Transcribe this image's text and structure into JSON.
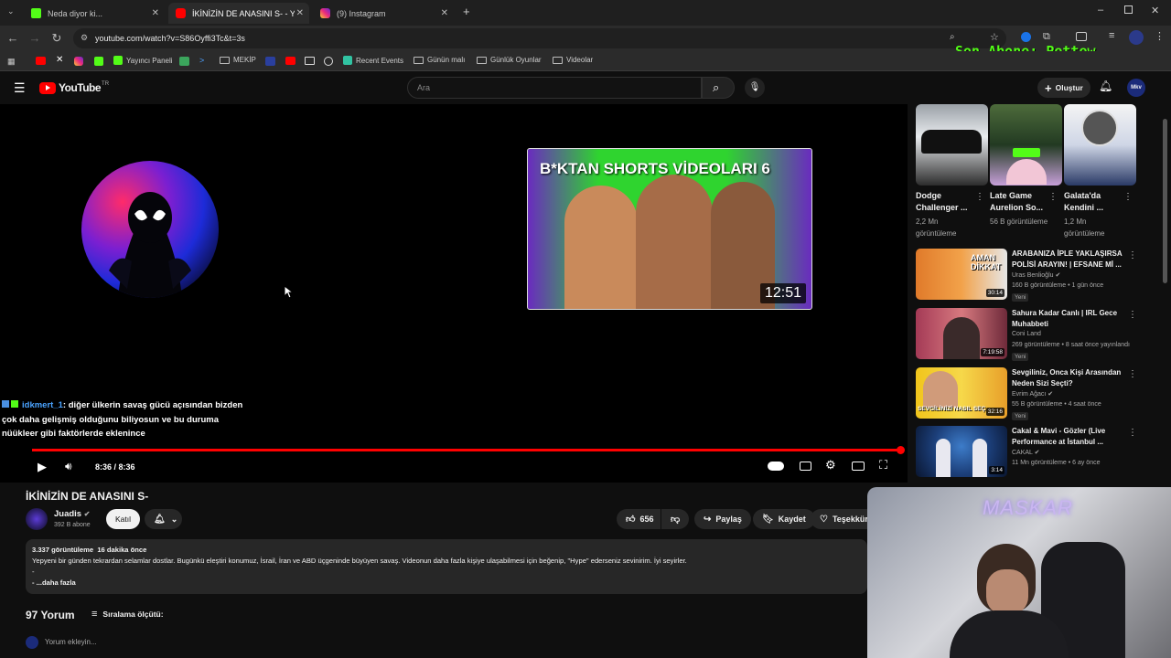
{
  "browser": {
    "tabs": [
      {
        "title": "Neda diyor ki...",
        "color": "#53fc18"
      },
      {
        "title": "İKİNİZİN DE ANASINI S- - YouT",
        "color": "#ff0000"
      },
      {
        "title": "(9) Instagram",
        "color": "#e1306c"
      }
    ],
    "url": "youtube.com/watch?v=S86Oyffi3Tc&t=3s",
    "bookmarks": [
      "Yayıncı Paneli",
      "MEKİP",
      "Recent Events",
      "Günün malı",
      "Günlük Oyunlar",
      "Videolar"
    ]
  },
  "overlay": {
    "last_subscriber": "Son Abone: Pettew",
    "webcam_label": "MASKAR"
  },
  "youtube": {
    "logo": "YouTube",
    "logo_region": "TR",
    "search_placeholder": "Ara",
    "create_label": "Oluştur",
    "avatar_text": "Mkv"
  },
  "player": {
    "endscreen_title": "B*KTAN SHORTS VİDEOLARI 6",
    "endscreen_duration": "12:51",
    "time": "8:36 / 8:36",
    "progress": 1.0,
    "chat_user": "idkmert_1",
    "chat_message": ": diğer ülkerin savaş gücü açısından bizden çok daha gelişmiş olduğunu biliyosun ve bu duruma nüükleer gibi faktörlerde eklenince"
  },
  "video": {
    "title": "İKİNİZİN DE ANASINI S-",
    "channel": "Juadis",
    "subscribers": "392 B abone",
    "join_label": "Katıl",
    "likes": "656",
    "share_label": "Paylaş",
    "save_label": "Kaydet",
    "thanks_label": "Teşekkür",
    "views_line": "3.337 görüntüleme  16 dakika önce",
    "description": "Yepyeni bir günden tekrardan selamlar dostlar. Bugünkü eleştiri konumuz, İsrail, İran ve ABD üçgeninde büyüyen savaş. Videonun daha fazla kişiye ulaşabilmesi için beğenip, \"Hype\" ederseniz sevinirim. İyi seyirler.",
    "desc_dash1": "-",
    "desc_more": "- ...daha fazla",
    "comments_count": "97 Yorum",
    "sort_label": "Sıralama ölçütü:",
    "comment_placeholder": "Yorum ekleyin..."
  },
  "top_videos": [
    {
      "title": "Dodge Challenger ...",
      "views": "2,2 Mn görüntüleme"
    },
    {
      "title": "Late Game Aurelion So...",
      "views": "56 B görüntüleme"
    },
    {
      "title": "Galata'da Kendini ...",
      "views": "1,2 Mn görüntüleme"
    }
  ],
  "recommendations": [
    {
      "title": "ARABANIZA İPLE YAKLAŞIRSA POLİSİ ARAYIN! | EFSANE Mİ ...",
      "channel": "Uras Benlioğlu ✔",
      "meta": "160 B görüntüleme • 1 gün önce",
      "new": "Yeni",
      "duration": "30:14",
      "thumb_text": "AMAN DİKKAT"
    },
    {
      "title": "Sahura Kadar Canlı | IRL Gece Muhabbeti",
      "channel": "Coni Land",
      "meta": "269 görüntüleme • 8 saat önce yayınlandı",
      "new": "Yeni",
      "duration": "7:19:58",
      "thumb_text": ""
    },
    {
      "title": "Sevgiliniz, Onca Kişi Arasından Neden Sizi Seçti?",
      "channel": "Evrim Ağacı ✔",
      "meta": "55 B görüntüleme • 4 saat önce",
      "new": "Yeni",
      "duration": "32:16",
      "thumb_text": "SEVGİLİNİZİ NASIL SEÇ"
    },
    {
      "title": "Cakal & Mavi - Gözler (Live Performance at İstanbul ...",
      "channel": "CAKAL ✔",
      "meta": "11 Mn görüntüleme • 6 ay önce",
      "new": "",
      "duration": "3:14",
      "thumb_text": ""
    }
  ],
  "colors": {
    "yt_red": "#ff0000",
    "kick_green": "#53fc18",
    "bg": "#0f0f0f"
  }
}
